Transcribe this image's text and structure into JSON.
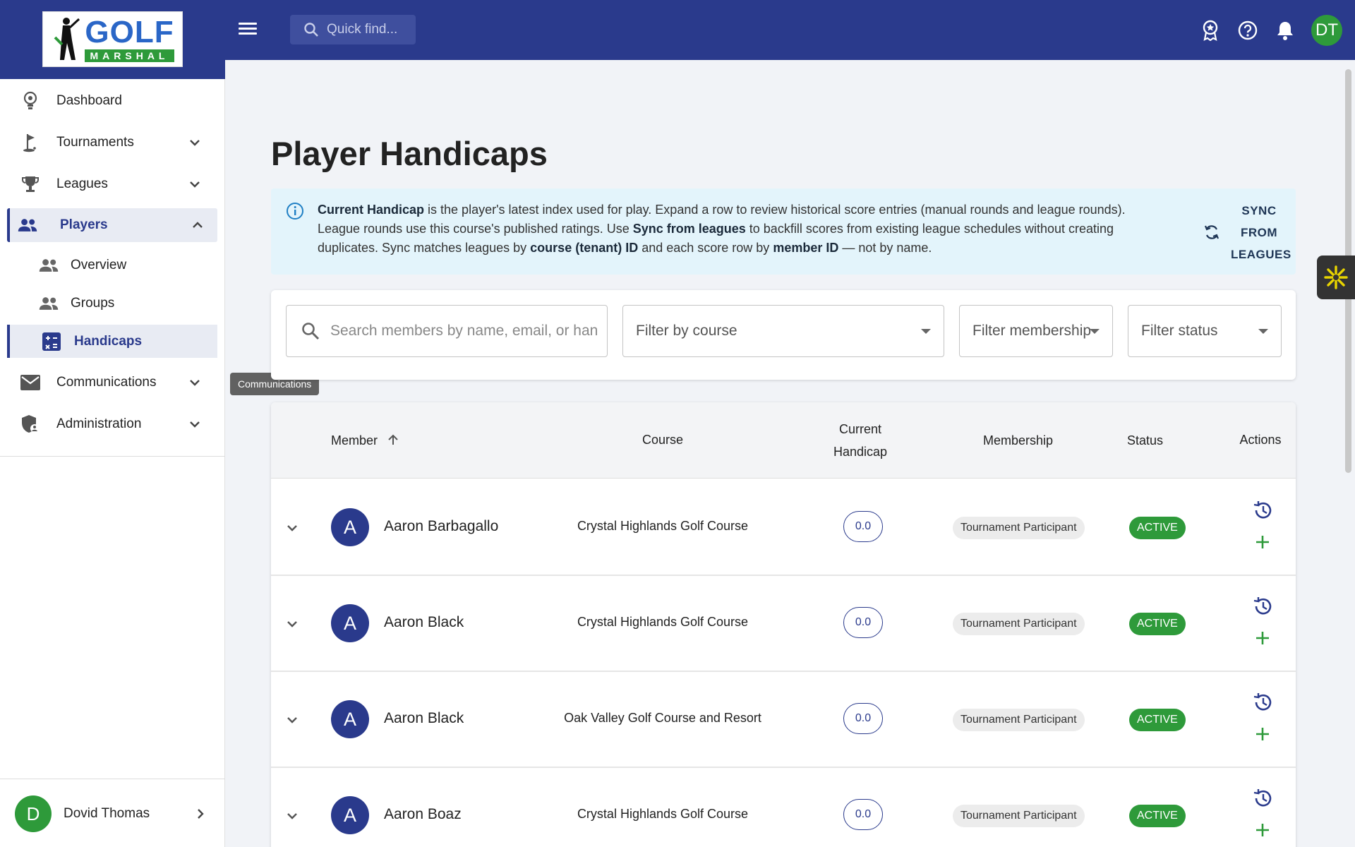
{
  "brand": {
    "logo_text": "GOLF",
    "logo_sub": "MARSHAL"
  },
  "topbar": {
    "search_placeholder": "Quick find...",
    "icons": [
      "award-icon",
      "help-icon",
      "bell-icon"
    ],
    "avatar_initials": "DT",
    "colors": {
      "bar": "#2a3a8c",
      "avatar": "#2e9a3a"
    }
  },
  "sidebar": {
    "items": [
      {
        "label": "Dashboard",
        "icon": "lightbulb-icon"
      },
      {
        "label": "Tournaments",
        "icon": "golf-flag-icon"
      },
      {
        "label": "Leagues",
        "icon": "trophy-icon"
      },
      {
        "label": "Players",
        "icon": "people-icon"
      },
      {
        "label": "Communications",
        "icon": "mail-icon"
      },
      {
        "label": "Administration",
        "icon": "admin-shield-icon"
      }
    ],
    "players_sub": [
      {
        "label": "Overview",
        "icon": "people-icon"
      },
      {
        "label": "Groups",
        "icon": "people-icon"
      },
      {
        "label": "Handicaps",
        "icon": "calculator-icon"
      }
    ],
    "tooltip": "Communications",
    "user": {
      "initial": "D",
      "name": "Dovid Thomas"
    }
  },
  "main": {
    "title": "Player Handicaps",
    "info": {
      "p1_bold": "Current Handicap",
      "p1_rest": " is the player's latest index used for play. Expand a row to review historical score entries (manual rounds and league rounds). League rounds use this course's published ratings. Use ",
      "p2_bold": "Sync from leagues",
      "p2_rest": " to backfill scores from existing league schedules without creating duplicates. Sync matches leagues by ",
      "p3_bold": "course (tenant) ID",
      "p3_rest": " and each score row by ",
      "p4_bold": "member ID",
      "p4_rest": " — not by name."
    },
    "sync_button": {
      "line1": "SYNC",
      "line2": "FROM",
      "line3": "LEAGUES"
    },
    "filters": {
      "search_placeholder": "Search members by name, email, or handicap",
      "course": "Filter by course",
      "membership": "Filter membership",
      "status": "Filter status"
    },
    "table": {
      "headers": {
        "member": "Member",
        "course": "Course",
        "handicap_line1": "Current",
        "handicap_line2": "Handicap",
        "membership": "Membership",
        "status": "Status",
        "actions": "Actions"
      },
      "rows": [
        {
          "initial": "A",
          "name": "Aaron Barbagallo",
          "course": "Crystal Highlands Golf Course",
          "handicap": "0.0",
          "membership": "Tournament Participant",
          "status": "ACTIVE"
        },
        {
          "initial": "A",
          "name": "Aaron Black",
          "course": "Crystal Highlands Golf Course",
          "handicap": "0.0",
          "membership": "Tournament Participant",
          "status": "ACTIVE"
        },
        {
          "initial": "A",
          "name": "Aaron Black",
          "course": "Oak Valley Golf Course and Resort",
          "handicap": "0.0",
          "membership": "Tournament Participant",
          "status": "ACTIVE"
        },
        {
          "initial": "A",
          "name": "Aaron Boaz",
          "course": "Crystal Highlands Golf Course",
          "handicap": "0.0",
          "membership": "Tournament Participant",
          "status": "ACTIVE"
        }
      ]
    }
  }
}
